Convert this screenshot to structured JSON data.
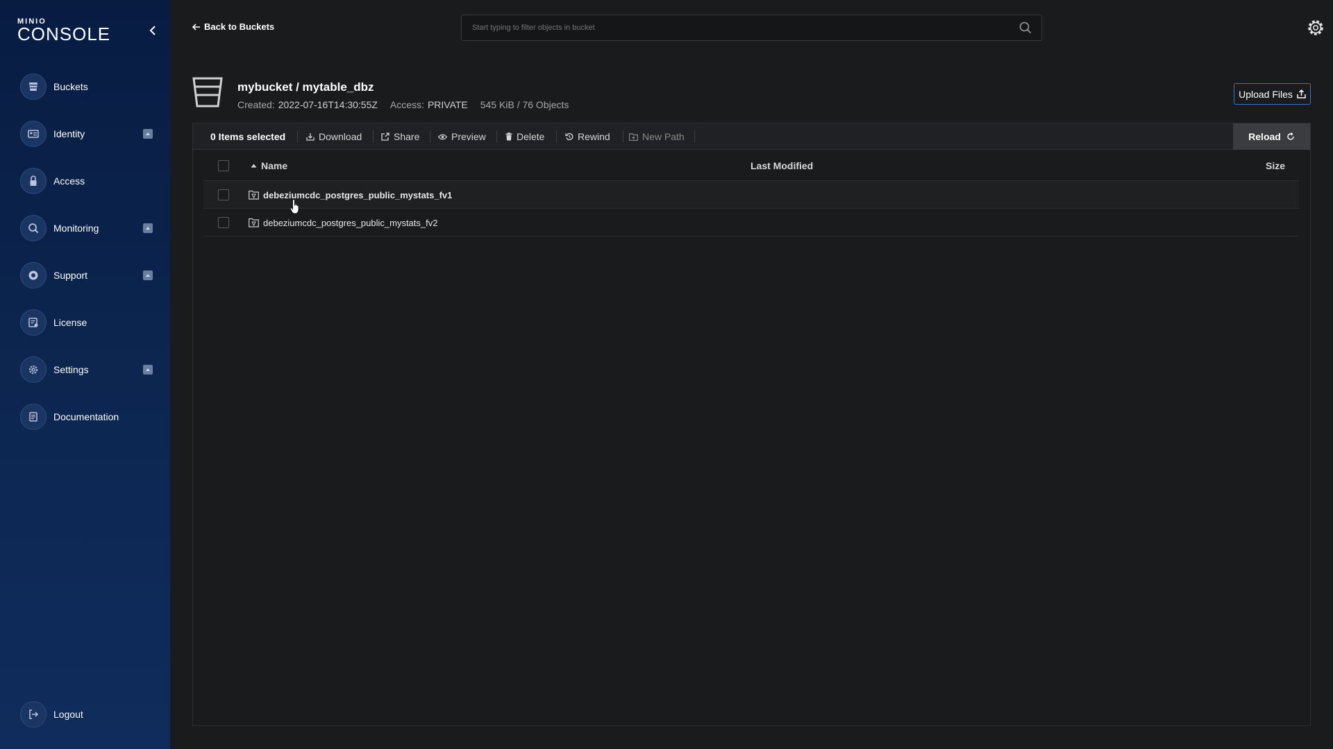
{
  "sidebar": {
    "logo": {
      "brand": "MINIO",
      "product": "CONSOLE"
    },
    "items": [
      {
        "label": "Buckets",
        "icon": "bucket-icon",
        "expandable": false
      },
      {
        "label": "Identity",
        "icon": "identity-icon",
        "expandable": true
      },
      {
        "label": "Access",
        "icon": "lock-icon",
        "expandable": false
      },
      {
        "label": "Monitoring",
        "icon": "magnifier-icon",
        "expandable": true
      },
      {
        "label": "Support",
        "icon": "lifebuoy-icon",
        "expandable": true
      },
      {
        "label": "License",
        "icon": "license-icon",
        "expandable": false
      },
      {
        "label": "Settings",
        "icon": "gear-icon",
        "expandable": true
      },
      {
        "label": "Documentation",
        "icon": "document-icon",
        "expandable": false
      }
    ],
    "logout_label": "Logout"
  },
  "topbar": {
    "back_label": "Back to Buckets",
    "search_placeholder": "Start typing to filter objects in bucket",
    "search_value": ""
  },
  "bucket": {
    "title": "mybucket / mytable_dbz",
    "created_label": "Created:",
    "created_value": "2022-07-16T14:30:55Z",
    "access_label": "Access:",
    "access_value": "PRIVATE",
    "size_summary": "545 KiB / 76 Objects",
    "upload_label": "Upload Files"
  },
  "toolbar": {
    "selected_label": "0 Items selected",
    "download_label": "Download",
    "share_label": "Share",
    "preview_label": "Preview",
    "delete_label": "Delete",
    "rewind_label": "Rewind",
    "new_path_label": "New Path",
    "reload_label": "Reload"
  },
  "table": {
    "columns": {
      "name": "Name",
      "last_modified": "Last Modified",
      "size": "Size"
    },
    "rows": [
      {
        "name": "debeziumcdc_postgres_public_mystats_fv1",
        "last_modified": "",
        "size": ""
      },
      {
        "name": "debeziumcdc_postgres_public_mystats_fv2",
        "last_modified": "",
        "size": ""
      }
    ]
  },
  "colors": {
    "sidebar_top": "#081c42",
    "sidebar_bottom": "#0f2c5c",
    "background": "#1a1b1d",
    "accent_border": "#3d74c6",
    "reload_bg": "#3b3c3f"
  }
}
